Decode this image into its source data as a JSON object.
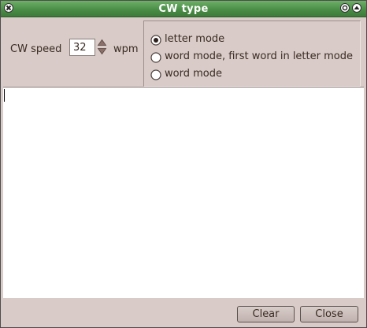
{
  "window": {
    "title": "CW type"
  },
  "speed": {
    "label": "CW speed",
    "value": "32",
    "unit": "wpm"
  },
  "modes": [
    {
      "label": "letter mode",
      "selected": true
    },
    {
      "label": "word mode, first word in letter mode",
      "selected": false
    },
    {
      "label": "word mode",
      "selected": false
    }
  ],
  "buttons": {
    "clear": "Clear",
    "close": "Close"
  },
  "colors": {
    "titlebar": "#4a8e47",
    "panel": "#d8cbc8",
    "text": "#3a2a22"
  }
}
